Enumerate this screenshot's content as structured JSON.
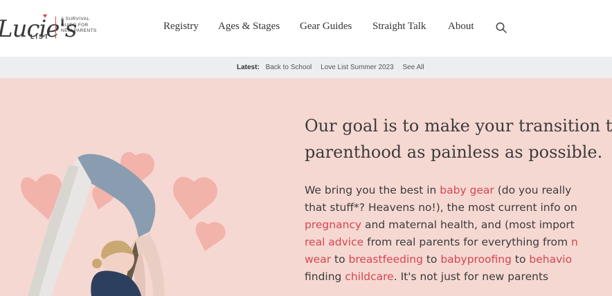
{
  "brand": {
    "script": "Lucie's",
    "list": "LIST",
    "tagline": [
      "A SURVIVAL",
      "GUIDE FOR",
      "NEW PARENTS"
    ],
    "accent_color": "#d6454f"
  },
  "nav": {
    "items": [
      {
        "label": "Registry"
      },
      {
        "label": "Ages & Stages"
      },
      {
        "label": "Gear Guides"
      },
      {
        "label": "Straight Talk"
      },
      {
        "label": "About"
      }
    ],
    "search_icon": "search-icon"
  },
  "latest": {
    "label": "Latest:",
    "links": [
      "Back to School",
      "Love List Summer 2023",
      "See All"
    ]
  },
  "hero": {
    "background_color": "#f6d8d2",
    "title_lines": [
      "Our goal is to make your transition t",
      "parenthood as painless as possible."
    ],
    "body": {
      "l1_a": "We bring you the best in ",
      "l1_b": "baby gear",
      "l1_c": " (do you really",
      "l2": "that stuff*? Heavens no!), the most current info on",
      "l3_a": "pregnancy",
      "l3_b": " and maternal health, and (most import",
      "l4_a": "real advice",
      "l4_b": " from real parents for everything from ",
      "l4_c": "n",
      "l5_a": "wear",
      "l5_b": " to ",
      "l5_c": "breastfeeding",
      "l5_d": " to ",
      "l5_e": "babyproofing",
      "l5_f": " to ",
      "l5_g": "behavio",
      "l6_a": "finding ",
      "l6_b": "childcare",
      "l6_c": ". It's not just for new parents"
    }
  }
}
